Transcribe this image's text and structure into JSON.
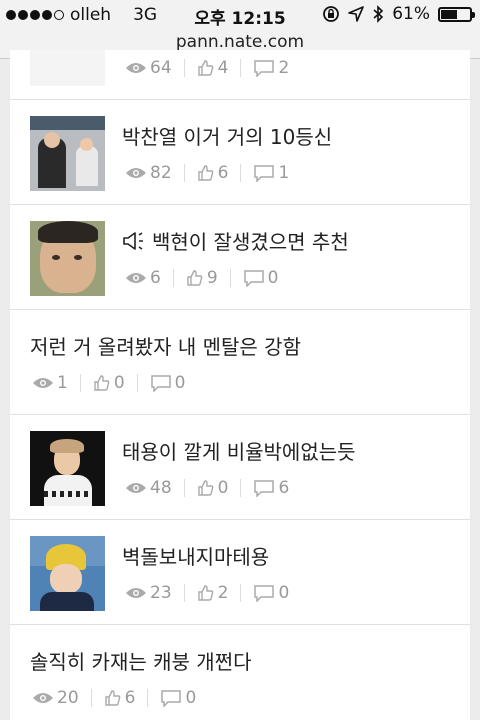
{
  "status": {
    "carrier": "olleh",
    "network": "3G",
    "time": "오후 12:15",
    "battery": "61%",
    "battery_level": 0.61
  },
  "browser": {
    "url": "pann.nate.com"
  },
  "posts": [
    {
      "title": "",
      "views": "64",
      "likes": "4",
      "comments": "2",
      "has_thumb": true
    },
    {
      "title": "박찬열 이거 거의 10등신",
      "views": "82",
      "likes": "6",
      "comments": "1",
      "has_thumb": true
    },
    {
      "title": "백현이 잘생겼으면 추천",
      "views": "6",
      "likes": "9",
      "comments": "0",
      "has_thumb": true,
      "icon": "speaker-icon"
    },
    {
      "title": "저런 거 올려봤자 내 멘탈은 강함",
      "views": "1",
      "likes": "0",
      "comments": "0",
      "has_thumb": false
    },
    {
      "title": "태용이 깔게 비율박에없는듯",
      "views": "48",
      "likes": "0",
      "comments": "6",
      "has_thumb": true
    },
    {
      "title": "벽돌보내지마테용",
      "views": "23",
      "likes": "2",
      "comments": "0",
      "has_thumb": true
    },
    {
      "title": "솔직히 카재는 캐붕 개쩐다",
      "views": "20",
      "likes": "6",
      "comments": "0",
      "has_thumb": false
    }
  ]
}
